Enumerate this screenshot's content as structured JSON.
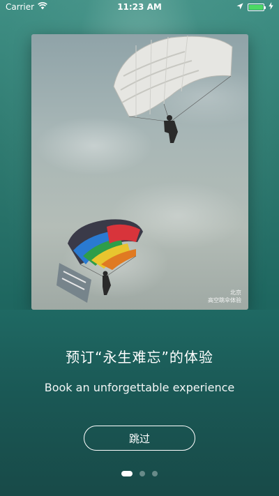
{
  "status_bar": {
    "carrier": "Carrier",
    "time": "11:23 AM",
    "wifi_icon": "wifi-icon",
    "location_icon": "location-arrow-icon",
    "charging_icon": "charging-bolt-icon",
    "battery_level": 1.0,
    "battery_color": "#4cd964"
  },
  "photo": {
    "caption_line1": "北京",
    "caption_line2": "高空跳伞体验"
  },
  "onboarding": {
    "headline": "预订“永生难忘”的体验",
    "subline": "Book an unforgettable experience",
    "skip_label": "跳过",
    "page_count": 3,
    "current_page": 1
  }
}
